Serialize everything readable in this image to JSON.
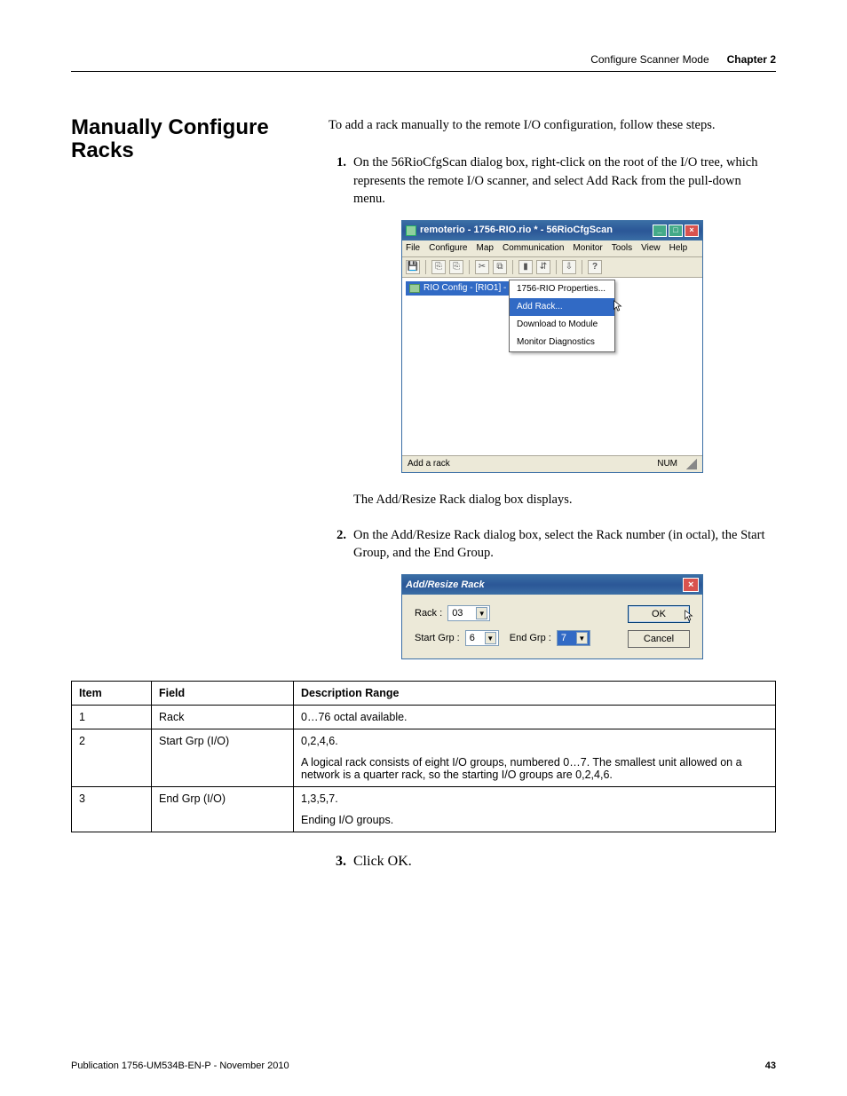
{
  "header": {
    "section": "Configure Scanner Mode",
    "chapter": "Chapter 2"
  },
  "side_heading": "Manually Configure Racks",
  "intro": "To add a rack manually to the remote I/O configuration, follow these steps.",
  "steps": {
    "s1": {
      "num": "1.",
      "text": "On the 56RioCfgScan dialog box, right-click on the root of the I/O tree, which represents the remote I/O scanner, and select Add Rack from the pull-down menu."
    },
    "after1": "The Add/Resize Rack dialog box displays.",
    "s2": {
      "num": "2.",
      "text": "On the Add/Resize Rack dialog box, select the Rack number (in octal), the Start Group, and the End Group."
    },
    "s3": {
      "num": "3.",
      "text": "Click OK."
    }
  },
  "app_window": {
    "title": "remoterio - 1756-RIO.rio * - 56RioCfgScan",
    "menu": [
      "File",
      "Configure",
      "Map",
      "Communication",
      "Monitor",
      "Tools",
      "View",
      "Help"
    ],
    "tree_item": "RIO Config - [RIO1] -",
    "context": [
      "1756-RIO Properties...",
      "Add Rack...",
      "Download to Module",
      "Monitor Diagnostics"
    ],
    "status_left": "Add a rack",
    "status_right": "NUM"
  },
  "dialog": {
    "title": "Add/Resize Rack",
    "labels": {
      "rack": "Rack :",
      "startgrp": "Start Grp :",
      "endgrp": "End Grp :"
    },
    "values": {
      "rack": "03",
      "startgrp": "6",
      "endgrp": "7"
    },
    "ok": "OK",
    "cancel": "Cancel"
  },
  "table": {
    "headers": [
      "Item",
      "Field",
      "Description Range"
    ],
    "rows": [
      {
        "item": "1",
        "field": "Rack",
        "desc": [
          "0…76 octal available."
        ]
      },
      {
        "item": "2",
        "field": "Start Grp (I/O)",
        "desc": [
          "0,2,4,6.",
          "A logical rack consists of eight I/O groups, numbered 0…7. The smallest unit allowed on a network is a quarter rack, so the starting I/O groups are 0,2,4,6."
        ]
      },
      {
        "item": "3",
        "field": "End Grp (I/O)",
        "desc": [
          "1,3,5,7.",
          "Ending I/O groups."
        ]
      }
    ]
  },
  "footer": {
    "pub": "Publication 1756-UM534B-EN-P - November 2010",
    "page": "43"
  }
}
